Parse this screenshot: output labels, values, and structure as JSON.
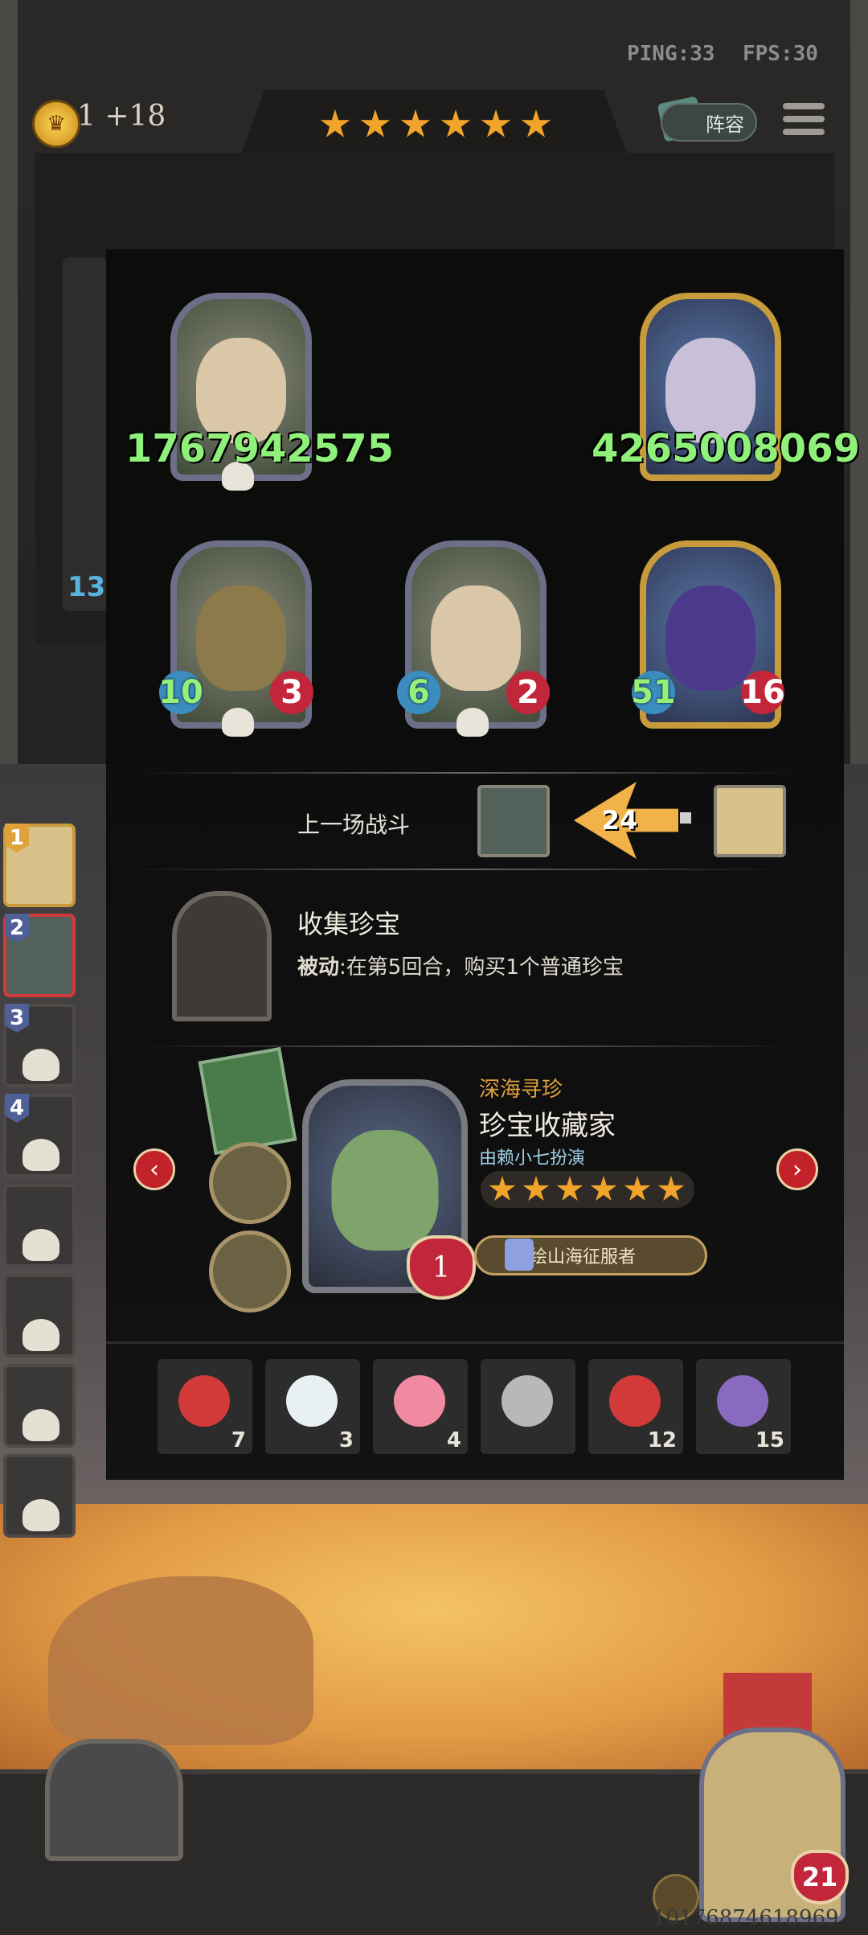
{
  "hud": {
    "ping": "PING:33",
    "fps": "FPS:30",
    "coin_text": "1 +18",
    "stars": 6,
    "lineup_label": "阵容"
  },
  "board": {
    "top_row": [
      {
        "name": "pirate-portrait",
        "big_number": "1767942575",
        "style": "purple"
      },
      {
        "name": "wizard-portrait",
        "big_number": "4265008069",
        "style": "gold"
      }
    ],
    "bottom_row": [
      {
        "name": "robot-pile-portrait",
        "attack": "10",
        "health": "3",
        "style": "purple"
      },
      {
        "name": "pirate-portrait-2",
        "attack": "6",
        "health": "2",
        "style": "purple"
      },
      {
        "name": "sea-dragon-portrait",
        "attack": "51",
        "health": "16",
        "style": "gold"
      }
    ],
    "side_number": "13"
  },
  "last_battle": {
    "label": "上一场战斗",
    "damage": "24"
  },
  "ability": {
    "title": "收集珍宝",
    "type": "被动",
    "description": ":在第5回合，购买1个普通珍宝"
  },
  "hero": {
    "subtitle": "深海寻珍",
    "name": "珍宝收藏家",
    "voice": "由赖小七扮演",
    "stars": 6,
    "level": "1",
    "title_badge": "墨绘山海征服者"
  },
  "items": [
    {
      "name": "alarm-clock-icon",
      "count": "7"
    },
    {
      "name": "teacup-icon",
      "count": "3"
    },
    {
      "name": "cupcake-icon",
      "count": "4"
    },
    {
      "name": "fish-head-icon",
      "count": ""
    },
    {
      "name": "clown-icon",
      "count": "12"
    },
    {
      "name": "shield-mirror-icon",
      "count": "15"
    }
  ],
  "ranking": [
    {
      "rank": "1"
    },
    {
      "rank": "2"
    },
    {
      "rank": "3"
    },
    {
      "rank": "4"
    },
    {
      "rank": ""
    },
    {
      "rank": ""
    },
    {
      "rank": ""
    },
    {
      "rank": ""
    }
  ],
  "player": {
    "health": "21",
    "id_text": "10176874618969"
  },
  "colors": {
    "accent_gold": "#f2a32a",
    "health_red": "#c2263a",
    "attack_green": "#8ff07a",
    "subtitle_orange": "#e0a23a"
  }
}
